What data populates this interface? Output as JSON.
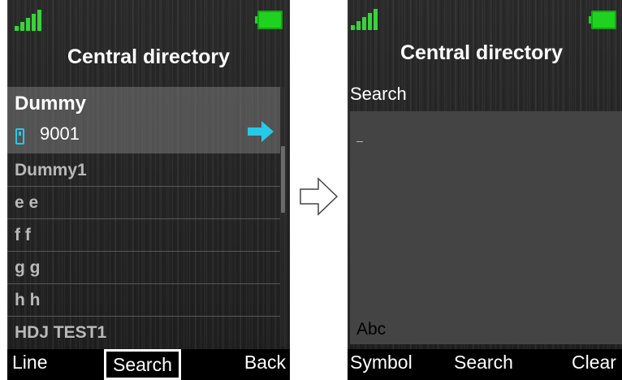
{
  "left_screen": {
    "title": "Central directory",
    "selected_contact": {
      "name": "Dummy",
      "number": "9001"
    },
    "items": [
      {
        "name": "Dummy1"
      },
      {
        "name": "e e"
      },
      {
        "name": "f f"
      },
      {
        "name": "g g"
      },
      {
        "name": "h h"
      },
      {
        "name": "HDJ TEST1"
      }
    ],
    "softkeys": {
      "left": "Line",
      "middle": "Search",
      "right": "Back"
    }
  },
  "right_screen": {
    "title": "Central directory",
    "search_label": "Search",
    "input_value": "-",
    "input_mode": "Abc",
    "softkeys": {
      "left": "Symbol",
      "middle": "Search",
      "right": "Clear"
    }
  },
  "colors": {
    "signal": "#37d33a",
    "battery": "#1fd21f",
    "accent": "#27c8e8"
  }
}
